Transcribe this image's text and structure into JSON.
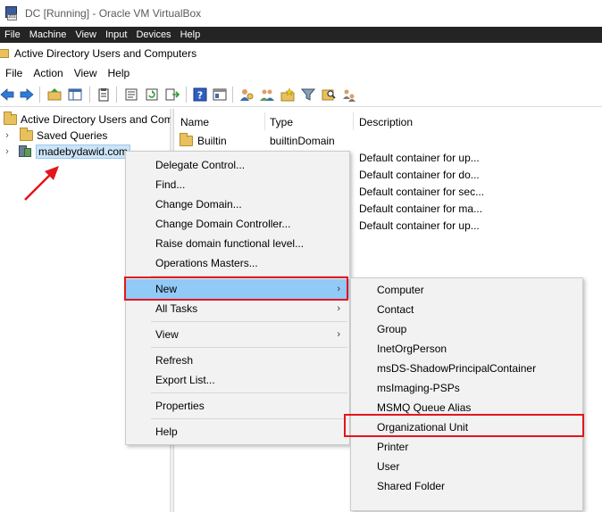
{
  "vbox": {
    "title": "DC [Running] - Oracle VM VirtualBox",
    "menu": [
      "File",
      "Machine",
      "View",
      "Input",
      "Devices",
      "Help"
    ]
  },
  "mmc": {
    "title": "Active Directory Users and Computers",
    "menu": [
      "File",
      "Action",
      "View",
      "Help"
    ]
  },
  "toolbar_icons": [
    "back-icon",
    "forward-icon",
    "up-folder-icon",
    "show-hide-tree-icon",
    "clipboard-icon",
    "properties-icon",
    "refresh-icon",
    "export-list-icon",
    "help-icon",
    "console-icon",
    "users-icon",
    "groups-icon",
    "new-ou-icon",
    "filter-icon",
    "find-icon",
    "delegate-icon"
  ],
  "tree": {
    "root": "Active Directory Users and Com",
    "saved_queries": "Saved Queries",
    "domain": "madebydawid.com"
  },
  "list": {
    "columns": [
      "Name",
      "Type",
      "Description"
    ],
    "rows": [
      {
        "name": "Builtin",
        "type": "builtinDomain",
        "description": ""
      },
      {
        "name": "",
        "type": "",
        "description": "Default container for up..."
      },
      {
        "name": "",
        "type": "",
        "description": "Default container for do..."
      },
      {
        "name": "",
        "type": "",
        "description": "Default container for sec..."
      },
      {
        "name": "",
        "type": "",
        "description": "Default container for ma..."
      },
      {
        "name": "",
        "type": "",
        "description": "Default container for up..."
      }
    ]
  },
  "context_menu": {
    "items": [
      "Delegate Control...",
      "Find...",
      "Change Domain...",
      "Change Domain Controller...",
      "Raise domain functional level...",
      "Operations Masters...",
      "New",
      "All Tasks",
      "View",
      "Refresh",
      "Export List...",
      "Properties",
      "Help"
    ]
  },
  "submenu": {
    "items": [
      "Computer",
      "Contact",
      "Group",
      "InetOrgPerson",
      "msDS-ShadowPrincipalContainer",
      "msImaging-PSPs",
      "MSMQ Queue Alias",
      "Organizational Unit",
      "Printer",
      "User",
      "Shared Folder"
    ]
  },
  "colors": {
    "highlight": "#91c9f7",
    "annotation_red": "#e3161b",
    "vbox_menu_bg": "#242424"
  }
}
